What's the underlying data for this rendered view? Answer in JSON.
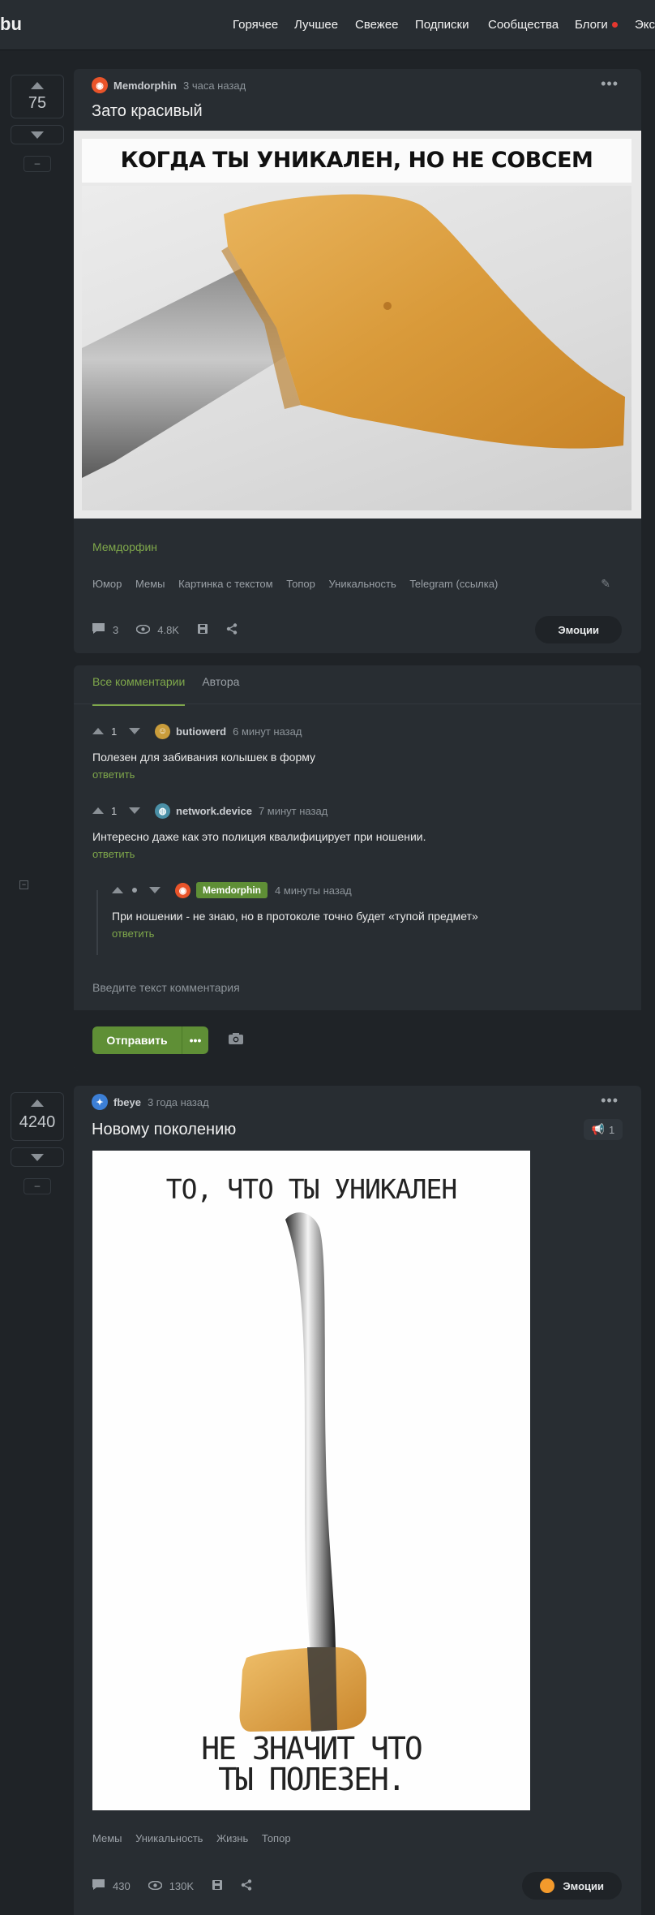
{
  "header": {
    "logo": "bu",
    "nav": [
      "Горячее",
      "Лучшее",
      "Свежее",
      "Подписки",
      "Сообщества",
      "Блоги",
      "Экс"
    ]
  },
  "post1": {
    "rating": "75",
    "author": "Memdorphin",
    "time": "3 часа назад",
    "title": "Зато красивый",
    "image_caption": "КОГДА ТЫ УНИКАЛЕН, НО НЕ СОВСЕМ ПОЛЕЗЕН",
    "community": "Мемдорфин",
    "tags": [
      "Юмор",
      "Мемы",
      "Картинка с текстом",
      "Топор",
      "Уникальность",
      "Telegram (ссылка)"
    ],
    "comments_count": "3",
    "views": "4.8K",
    "emotions_label": "Эмоции"
  },
  "comments": {
    "tab_all": "Все комментарии",
    "tab_author": "Автора",
    "items": [
      {
        "score": "1",
        "author": "butiowerd",
        "time": "6 минут назад",
        "text": "Полезен для забивания колышек в форму",
        "reply": "ответить"
      },
      {
        "score": "1",
        "author": "network.device",
        "time": "7 минут назад",
        "text": "Интересно даже как это полиция квалифицирует при ношении.",
        "reply": "ответить"
      },
      {
        "author": "Memdorphin",
        "time": "4 минуты назад",
        "text": "При ношении - не знаю, но в протоколе точно будет «тупой предмет»",
        "reply": "ответить"
      }
    ],
    "input_placeholder": "Введите текст комментария",
    "send_label": "Отправить",
    "more_label": "•••",
    "collapse_label": "−"
  },
  "post2": {
    "rating": "4240",
    "author": "fbeye",
    "time": "3 года назад",
    "title": "Новому поколению",
    "badge_count": "1",
    "image_caption_top": "ТО, ЧТО ТЫ УНИКАЛЕН",
    "image_caption_bottom_1": "НЕ ЗНАЧИТ ЧТО",
    "image_caption_bottom_2": "ТЫ ПОЛЕЗЕН.",
    "tags": [
      "Мемы",
      "Уникальность",
      "Жизнь",
      "Топор"
    ],
    "comments_count": "430",
    "views": "130K",
    "emotions_label": "Эмоции"
  },
  "ui": {
    "more_dots": "•••",
    "minus": "–"
  },
  "colors": {
    "accent_green": "#7fa84b",
    "button_green": "#5f8f36",
    "background": "#1f2327",
    "card": "#282d32",
    "notification_dot": "#e6372f"
  }
}
